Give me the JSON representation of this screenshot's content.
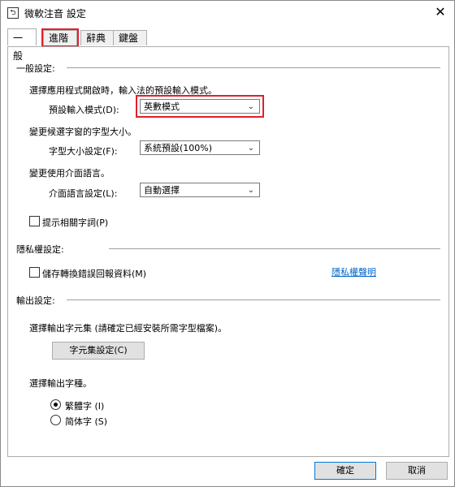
{
  "window": {
    "title": "微軟注音 設定",
    "close_glyph": "✕"
  },
  "tabs": [
    {
      "label": "一般"
    },
    {
      "label": "進階"
    },
    {
      "label": "辭典"
    },
    {
      "label": "鍵盤"
    }
  ],
  "general": {
    "section_title": "一般設定:",
    "input_mode_desc": "選擇應用程式開啟時，輸入法的預設輸入模式。",
    "input_mode_label": "預設輸入模式(D):",
    "input_mode_value": "英數模式",
    "font_size_desc": "變更候選字窗的字型大小。",
    "font_size_label": "字型大小設定(F):",
    "font_size_value": "系統預設(100%)",
    "ui_lang_desc": "變更使用介面語言。",
    "ui_lang_label": "介面語言設定(L):",
    "ui_lang_value": "自動選擇",
    "hint_related_label": "提示相關字詞(P)"
  },
  "privacy": {
    "section_title": "隱私權設定:",
    "store_error_label": "儲存轉換錯誤回報資料(M)",
    "statement_link": "隱私權聲明"
  },
  "output": {
    "section_title": "輸出設定:",
    "charset_desc": "選擇輸出字元集 (請確定已經安裝所需字型檔案)。",
    "charset_button": "字元集設定(C)",
    "script_desc": "選擇輸出字種。",
    "traditional_label": "繁體字 (I)",
    "simplified_label": "简体字 (S)",
    "selected": "traditional"
  },
  "footer": {
    "ok_label": "確定",
    "cancel_label": "取消"
  },
  "colors": {
    "highlight": "#e0202a",
    "link": "#0066cc"
  }
}
